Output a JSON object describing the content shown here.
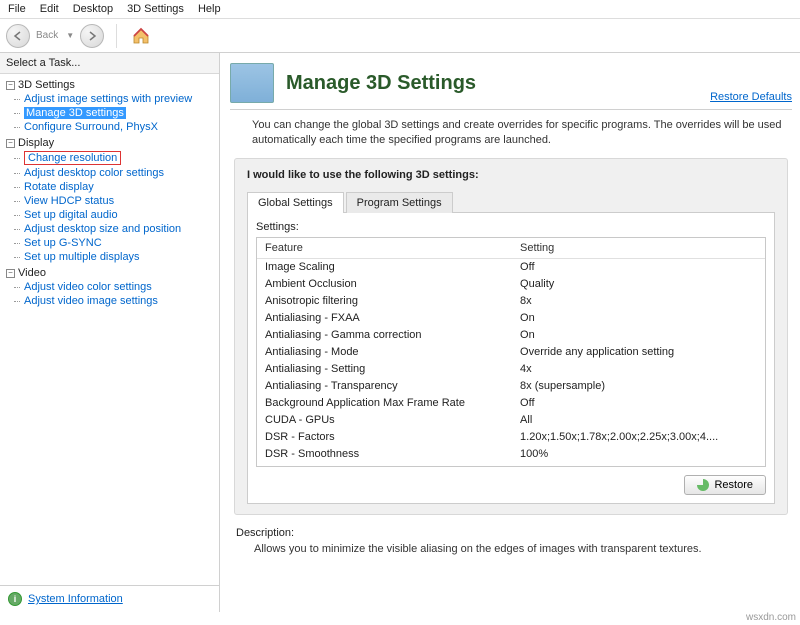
{
  "menubar": [
    "File",
    "Edit",
    "Desktop",
    "3D Settings",
    "Help"
  ],
  "toolbar": {
    "back": "Back"
  },
  "sidebar": {
    "header": "Select a Task...",
    "groups": [
      {
        "label": "3D Settings",
        "items": [
          {
            "label": "Adjust image settings with preview"
          },
          {
            "label": "Manage 3D settings",
            "selected": true
          },
          {
            "label": "Configure Surround, PhysX"
          }
        ]
      },
      {
        "label": "Display",
        "items": [
          {
            "label": "Change resolution",
            "highlighted": true
          },
          {
            "label": "Adjust desktop color settings"
          },
          {
            "label": "Rotate display"
          },
          {
            "label": "View HDCP status"
          },
          {
            "label": "Set up digital audio"
          },
          {
            "label": "Adjust desktop size and position"
          },
          {
            "label": "Set up G-SYNC"
          },
          {
            "label": "Set up multiple displays"
          }
        ]
      },
      {
        "label": "Video",
        "items": [
          {
            "label": "Adjust video color settings"
          },
          {
            "label": "Adjust video image settings"
          }
        ]
      }
    ],
    "footer": "System Information"
  },
  "page": {
    "title": "Manage 3D Settings",
    "restore_defaults": "Restore Defaults",
    "description": "You can change the global 3D settings and create overrides for specific programs. The overrides will be used automatically each time the specified programs are launched.",
    "panel_title": "I would like to use the following 3D settings:",
    "tabs": [
      "Global Settings",
      "Program Settings"
    ],
    "settings_label": "Settings:",
    "columns": [
      "Feature",
      "Setting"
    ],
    "rows": [
      {
        "f": "Image Scaling",
        "s": "Off"
      },
      {
        "f": "Ambient Occlusion",
        "s": "Quality"
      },
      {
        "f": "Anisotropic filtering",
        "s": "8x"
      },
      {
        "f": "Antialiasing - FXAA",
        "s": "On"
      },
      {
        "f": "Antialiasing - Gamma correction",
        "s": "On"
      },
      {
        "f": "Antialiasing - Mode",
        "s": "Override any application setting"
      },
      {
        "f": "Antialiasing - Setting",
        "s": "4x"
      },
      {
        "f": "Antialiasing - Transparency",
        "s": "8x (supersample)"
      },
      {
        "f": "Background Application Max Frame Rate",
        "s": "Off"
      },
      {
        "f": "CUDA - GPUs",
        "s": "All"
      },
      {
        "f": "DSR - Factors",
        "s": "1.20x;1.50x;1.78x;2.00x;2.25x;3.00x;4...."
      },
      {
        "f": "DSR - Smoothness",
        "s": "100%"
      }
    ],
    "restore_btn": "Restore"
  },
  "description_block": {
    "label": "Description:",
    "text": "Allows you to minimize the visible aliasing on the edges of images with transparent textures."
  },
  "watermark": "wsxdn.com"
}
